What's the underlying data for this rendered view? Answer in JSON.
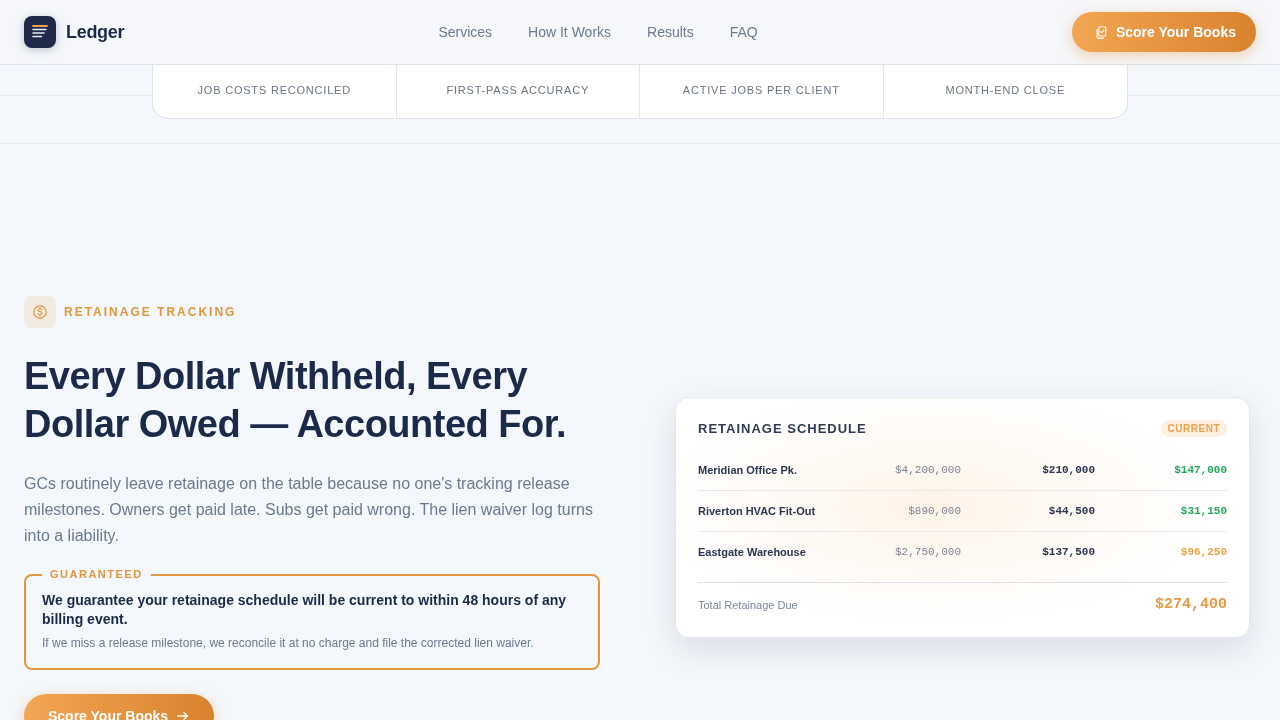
{
  "header": {
    "brand": "Ledger",
    "nav": [
      {
        "label": "Services"
      },
      {
        "label": "How It Works"
      },
      {
        "label": "Results"
      },
      {
        "label": "FAQ"
      }
    ],
    "cta": "Score Your Books"
  },
  "stats": [
    {
      "label": "JOB COSTS RECONCILED"
    },
    {
      "label": "FIRST-PASS ACCURACY"
    },
    {
      "label": "ACTIVE JOBS PER CLIENT"
    },
    {
      "label": "MONTH-END CLOSE"
    }
  ],
  "feature": {
    "eyebrow": "RETAINAGE TRACKING",
    "heading": "Every Dollar Withheld, Every Dollar Owed — Accounted For.",
    "body": "GCs routinely leave retainage on the table because no one's tracking release milestones. Owners get paid late. Subs get paid wrong. The lien waiver log turns into a liability.",
    "guarantee": {
      "legend": "GUARANTEED",
      "statement": "We guarantee your retainage schedule will be current to within 48 hours of any billing event.",
      "note": "If we miss a release milestone, we reconcile it at no charge and file the corrected lien waiver."
    },
    "cta": "Score Your Books"
  },
  "schedule": {
    "title": "RETAINAGE SCHEDULE",
    "badge": "CURRENT",
    "rows": [
      {
        "project": "Meridian Office Pk.",
        "contract": "$4,200,000",
        "retainage": "$210,000",
        "balance": "$147,000",
        "color": "#22a75a"
      },
      {
        "project": "Riverton HVAC Fit-Out",
        "contract": "$890,000",
        "retainage": "$44,500",
        "balance": "$31,150",
        "color": "#22a75a"
      },
      {
        "project": "Eastgate Warehouse",
        "contract": "$2,750,000",
        "retainage": "$137,500",
        "balance": "$96,250",
        "color": "#eda24a"
      }
    ],
    "total_label": "Total Retainage Due",
    "total": "$274,400"
  }
}
